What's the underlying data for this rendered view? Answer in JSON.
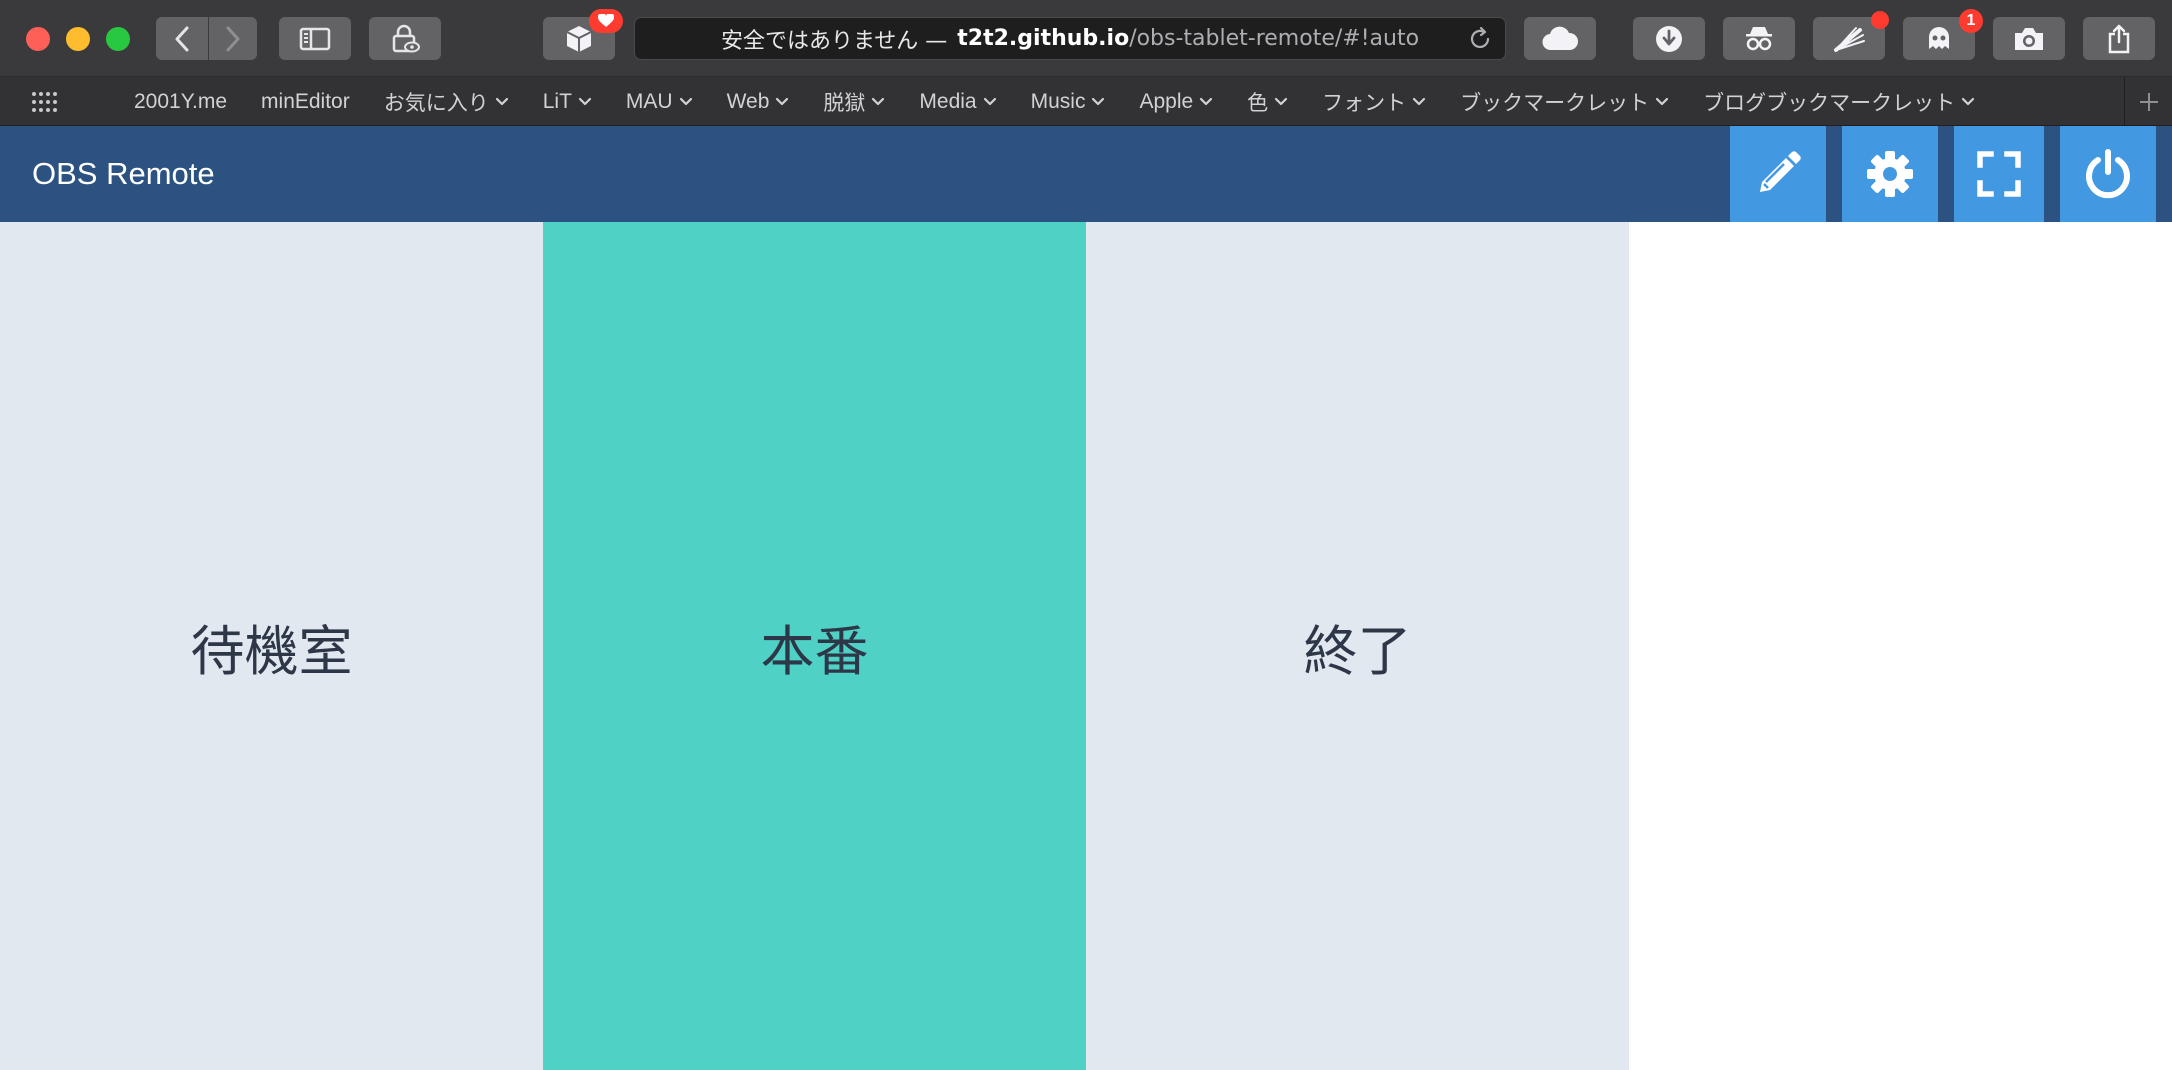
{
  "browser": {
    "url": {
      "security_warning": "安全ではありません —",
      "host": "t2t2.github.io",
      "path": "/obs-tablet-remote/#!auto"
    },
    "badges": {
      "extension_count": "1"
    }
  },
  "bookmarks": {
    "items": [
      {
        "label": "2001Y.me",
        "menu": false
      },
      {
        "label": "minEditor",
        "menu": false
      },
      {
        "label": "お気に入り",
        "menu": true
      },
      {
        "label": "LiT",
        "menu": true
      },
      {
        "label": "MAU",
        "menu": true
      },
      {
        "label": "Web",
        "menu": true
      },
      {
        "label": "脱獄",
        "menu": true
      },
      {
        "label": "Media",
        "menu": true
      },
      {
        "label": "Music",
        "menu": true
      },
      {
        "label": "Apple",
        "menu": true
      },
      {
        "label": "色",
        "menu": true
      },
      {
        "label": "フォント",
        "menu": true
      },
      {
        "label": "ブックマークレット",
        "menu": true
      },
      {
        "label": "ブログブックマークレット",
        "menu": true
      }
    ]
  },
  "app": {
    "title": "OBS Remote",
    "header_buttons": [
      "pencil-icon",
      "gear-icon",
      "fullscreen-icon",
      "power-icon"
    ]
  },
  "scenes": [
    {
      "label": "待機室",
      "active": false
    },
    {
      "label": "本番",
      "active": true
    },
    {
      "label": "終了",
      "active": false
    }
  ],
  "colors": {
    "header": "#2c5282",
    "header_button": "#4299e1",
    "scene_inactive": "#e2e8f0",
    "scene_active": "#4fd1c5",
    "scene_text": "#2d3748"
  }
}
